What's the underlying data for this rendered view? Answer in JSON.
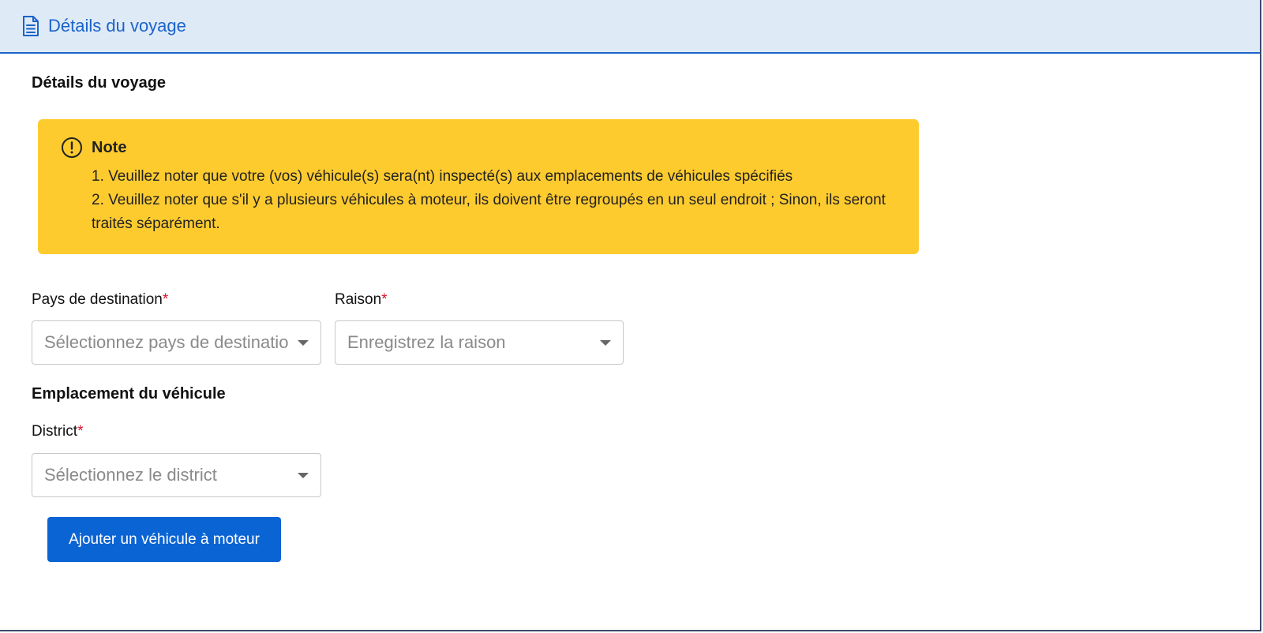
{
  "header": {
    "title": "Détails du voyage",
    "icon": "document-icon",
    "accent_color": "#1a63c9",
    "background_color": "#dfeaf7"
  },
  "section": {
    "title": "Détails du voyage"
  },
  "note": {
    "icon": "alert-circle-icon",
    "title": "Note",
    "items": [
      "1. Veuillez noter que votre (vos) véhicule(s) sera(nt) inspecté(s) aux emplacements de véhicules spécifiés",
      "2. Veuillez noter que s'il y a plusieurs véhicules à moteur, ils doivent être regroupés en un seul endroit ; Sinon, ils seront traités séparément."
    ],
    "background_color": "#fecb2f"
  },
  "fields": {
    "destination": {
      "label": "Pays de destination",
      "required_mark": "*",
      "placeholder": "Sélectionnez pays de destination"
    },
    "reason": {
      "label": "Raison",
      "required_mark": "*",
      "placeholder": "Enregistrez la raison"
    },
    "district": {
      "label": "District",
      "required_mark": "*",
      "placeholder": "Sélectionnez le district"
    }
  },
  "vehicle_location": {
    "title": "Emplacement du véhicule"
  },
  "actions": {
    "add_vehicle_label": "Ajouter un véhicule à moteur",
    "button_color": "#0b64d4"
  }
}
